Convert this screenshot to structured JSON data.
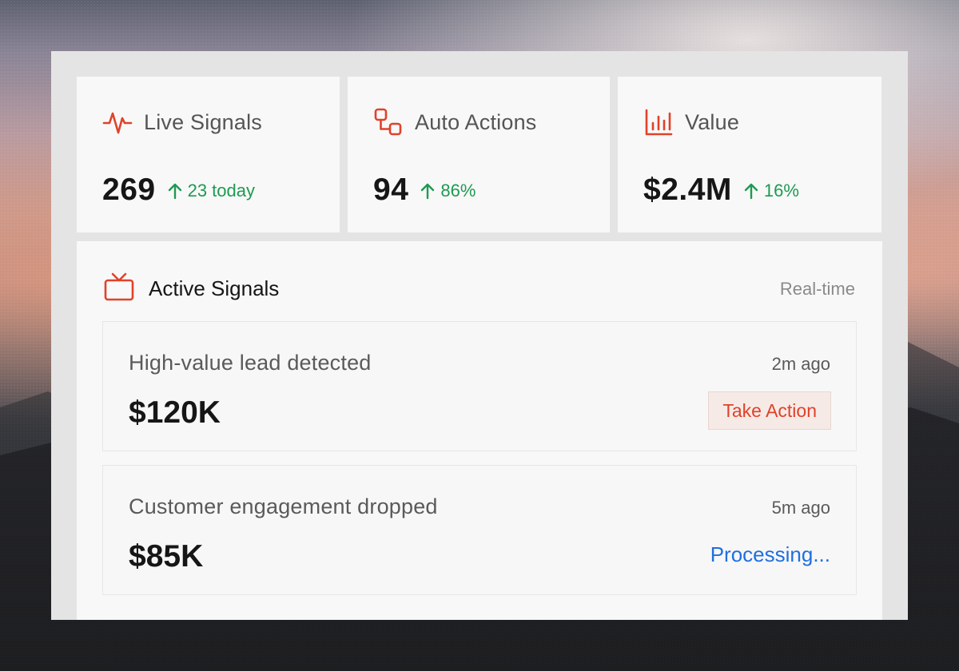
{
  "stats": [
    {
      "icon": "pulse-icon",
      "title": "Live Signals",
      "value": "269",
      "delta": "23 today",
      "delta_direction": "up"
    },
    {
      "icon": "workflow-icon",
      "title": "Auto Actions",
      "value": "94",
      "delta": "86%",
      "delta_direction": "up"
    },
    {
      "icon": "bar-chart-icon",
      "title": "Value",
      "value": "$2.4M",
      "delta": "16%",
      "delta_direction": "up"
    }
  ],
  "signals": {
    "icon": "tv-icon",
    "title": "Active Signals",
    "meta": "Real-time",
    "items": [
      {
        "description": "High-value lead detected",
        "time": "2m ago",
        "amount": "$120K",
        "action_label": "Take Action"
      },
      {
        "description": "Customer engagement dropped",
        "time": "5m ago",
        "amount": "$85K",
        "status": "Processing..."
      }
    ]
  },
  "colors": {
    "accent": "#e0422a",
    "positive": "#1e9a52",
    "link": "#1f6fe0",
    "panel_bg": "#e4e4e4",
    "card_bg": "#f8f8f8"
  }
}
